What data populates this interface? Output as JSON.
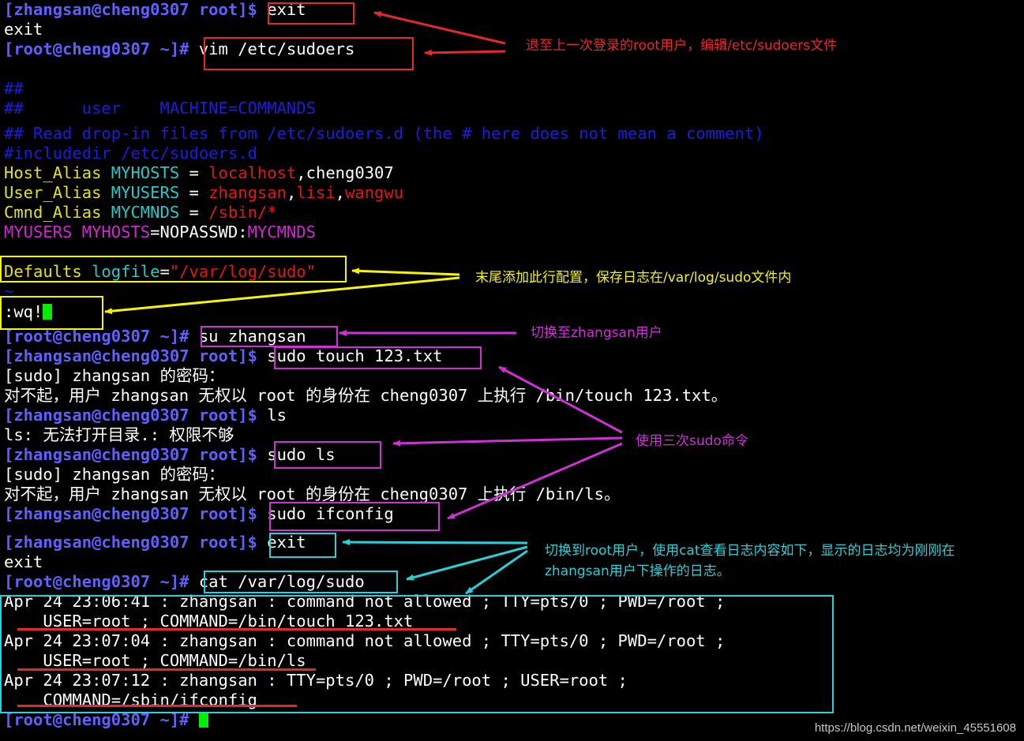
{
  "terminal": {
    "l1": {
      "prompt": "[zhangsan@cheng0307 root]$ ",
      "cmd": "exit"
    },
    "l2": {
      "out": "exit"
    },
    "l3": {
      "prompt": "[root@cheng0307 ~]# ",
      "cmd": "vim /etc/sudoers"
    },
    "l4": {
      "text": "##"
    },
    "l5": {
      "text": "##      user    MACHINE=COMMANDS"
    },
    "l6": {
      "text": "## Read drop-in files from /etc/sudoers.d (the # here does not mean a comment)"
    },
    "l7": {
      "text": "#includedir /etc/sudoers.d"
    },
    "l8": {
      "kw": "Host_Alias",
      "name": " MYHOSTS",
      "eq": " = ",
      "v1": "localhost",
      "v2": ",cheng0307"
    },
    "l9": {
      "kw": "User_Alias",
      "name": " MYUSERS",
      "eq": " = ",
      "v1": "zhangsan",
      "c1": ",",
      "v2": "lisi",
      "c2": ",",
      "v3": "wangwu"
    },
    "l10": {
      "kw": "Cmnd_Alias",
      "name": " MYCMNDS",
      "eq": " = ",
      "v1": "/sbin/*"
    },
    "l11": {
      "a": "MYUSERS MYHOSTS",
      "b": "=NOPASSWD:",
      "c": "MYCMNDS"
    },
    "l12": {
      "kw": "Defaults",
      "name": " logfile",
      "eq": "=",
      "v1": "\"/var/log/sudo\""
    },
    "l13": {
      "text": "~"
    },
    "l14": {
      "text": ":wq!"
    },
    "l15": {
      "prompt": "[root@cheng0307 ~]# ",
      "cmd": "su zhangsan"
    },
    "l16": {
      "prompt": "[zhangsan@cheng0307 root]$ ",
      "cmd": "sudo touch 123.txt"
    },
    "l17": {
      "out": "[sudo] zhangsan 的密码："
    },
    "l18": {
      "out": "对不起，用户 zhangsan 无权以 root 的身份在 cheng0307 上执行 /bin/touch 123.txt。"
    },
    "l19": {
      "prompt": "[zhangsan@cheng0307 root]$ ",
      "cmd": "ls"
    },
    "l20": {
      "out": "ls: 无法打开目录.: 权限不够"
    },
    "l21": {
      "prompt": "[zhangsan@cheng0307 root]$ ",
      "cmd": "sudo ls"
    },
    "l22": {
      "out": "[sudo] zhangsan 的密码："
    },
    "l23": {
      "out": "对不起，用户 zhangsan 无权以 root 的身份在 cheng0307 上执行 /bin/ls。"
    },
    "l24": {
      "prompt": "[zhangsan@cheng0307 root]$ ",
      "cmd": "sudo ifconfig"
    },
    "l25": {
      "prompt": "[zhangsan@cheng0307 root]$ ",
      "cmd": "exit"
    },
    "l26": {
      "out": "exit"
    },
    "l27": {
      "prompt": "[root@cheng0307 ~]# ",
      "cmd": "cat /var/log/sudo"
    },
    "l28": {
      "out": "Apr 24 23:06:41 : zhangsan : command not allowed ; TTY=pts/0 ; PWD=/root ;"
    },
    "l29": {
      "out": "    USER=root ; COMMAND=/bin/touch 123.txt"
    },
    "l30": {
      "out": "Apr 24 23:07:04 : zhangsan : command not allowed ; TTY=pts/0 ; PWD=/root ;"
    },
    "l31": {
      "out": "    USER=root ; COMMAND=/bin/ls"
    },
    "l32": {
      "out": "Apr 24 23:07:12 : zhangsan : TTY=pts/0 ; PWD=/root ; USER=root ;"
    },
    "l33": {
      "out": "    COMMAND=/sbin/ifconfig"
    },
    "l34": {
      "prompt": "[root@cheng0307 ~]# "
    }
  },
  "annotations": {
    "a1": "退至上一次登录的root用户，编辑/etc/sudoers文件",
    "a2": "末尾添加此行配置，保存日志在/var/log/sudo文件内",
    "a3": "切换至zhangsan用户",
    "a4": "使用三次sudo命令",
    "a5_line1": "切换到root用户，使用cat查看日志内容如下，显示的日志均为刚刚在",
    "a5_line2": "zhangsan用户下操作的日志。"
  },
  "watermark": "https://blog.csdn.net/weixin_45551608",
  "colors": {
    "background": "#000000",
    "prompt": "#6060ff",
    "comment": "#1c1ce0",
    "keyword": "#e2e222",
    "identifier": "#28c8c8",
    "string": "#e01818",
    "alias_line": "#d028d0",
    "cursor": "#00ee00",
    "anno_red": "#e8262e",
    "anno_yellow": "#f5f500",
    "anno_magenta": "#d030d8",
    "anno_cyan": "#2ad0d8"
  }
}
